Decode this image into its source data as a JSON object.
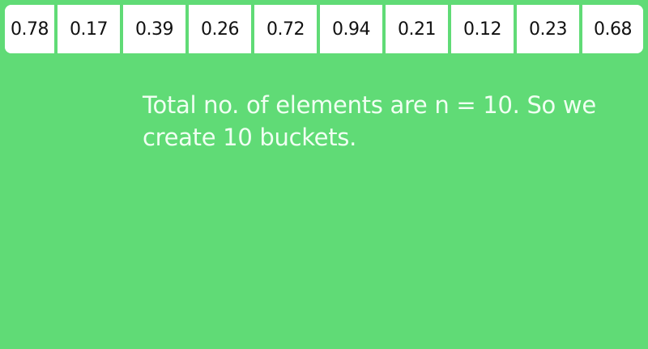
{
  "array": {
    "values": [
      "0.78",
      "0.17",
      "0.39",
      "0.26",
      "0.72",
      "0.94",
      "0.21",
      "0.12",
      "0.23",
      "0.68"
    ]
  },
  "caption": {
    "text": "Total no. of elements are n = 10. So we create 10 buckets."
  },
  "colors": {
    "background": "#60db76",
    "cell": "#ffffff",
    "cell_text": "#111111",
    "caption_text": "#f0fff2"
  }
}
